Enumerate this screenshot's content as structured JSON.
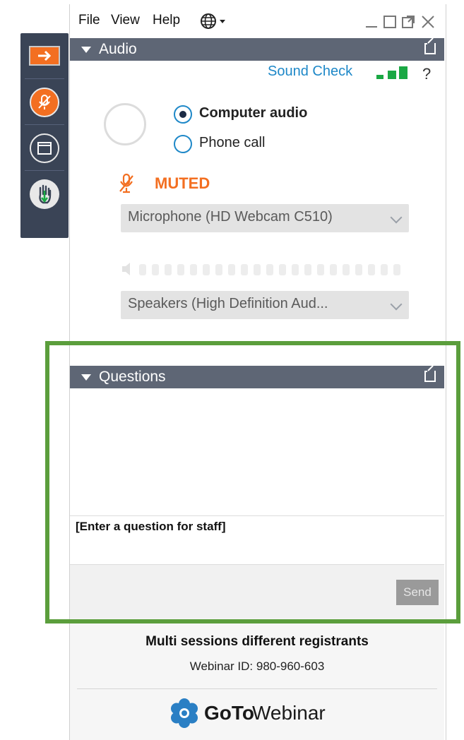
{
  "menu": {
    "file": "File",
    "view": "View",
    "help": "Help"
  },
  "audio": {
    "header": "Audio",
    "sound_check": "Sound Check",
    "help_mark": "?",
    "computer_audio": "Computer audio",
    "phone_call": "Phone call",
    "selected_option": "Computer audio",
    "muted": "MUTED",
    "microphone": "Microphone (HD Webcam C510)",
    "speakers": "Speakers (High  Definition Aud..."
  },
  "questions": {
    "header": "Questions",
    "placeholder": "[Enter a question for staff]",
    "send": "Send"
  },
  "footer": {
    "title": "Multi sessions different registrants",
    "webinar_id": "Webinar ID: 980-960-603",
    "logo_goto": "GoTo",
    "logo_webinar": "Webinar"
  },
  "colors": {
    "accent_blue": "#1e88c8",
    "muted_orange": "#f36f21",
    "signal_green": "#1aa844",
    "highlight_green": "#5b9e3c",
    "header_bar": "#5e6675"
  },
  "sidebar_icons": [
    "arrow-right-icon",
    "mic-muted-icon",
    "window-icon",
    "raise-hand-icon"
  ]
}
